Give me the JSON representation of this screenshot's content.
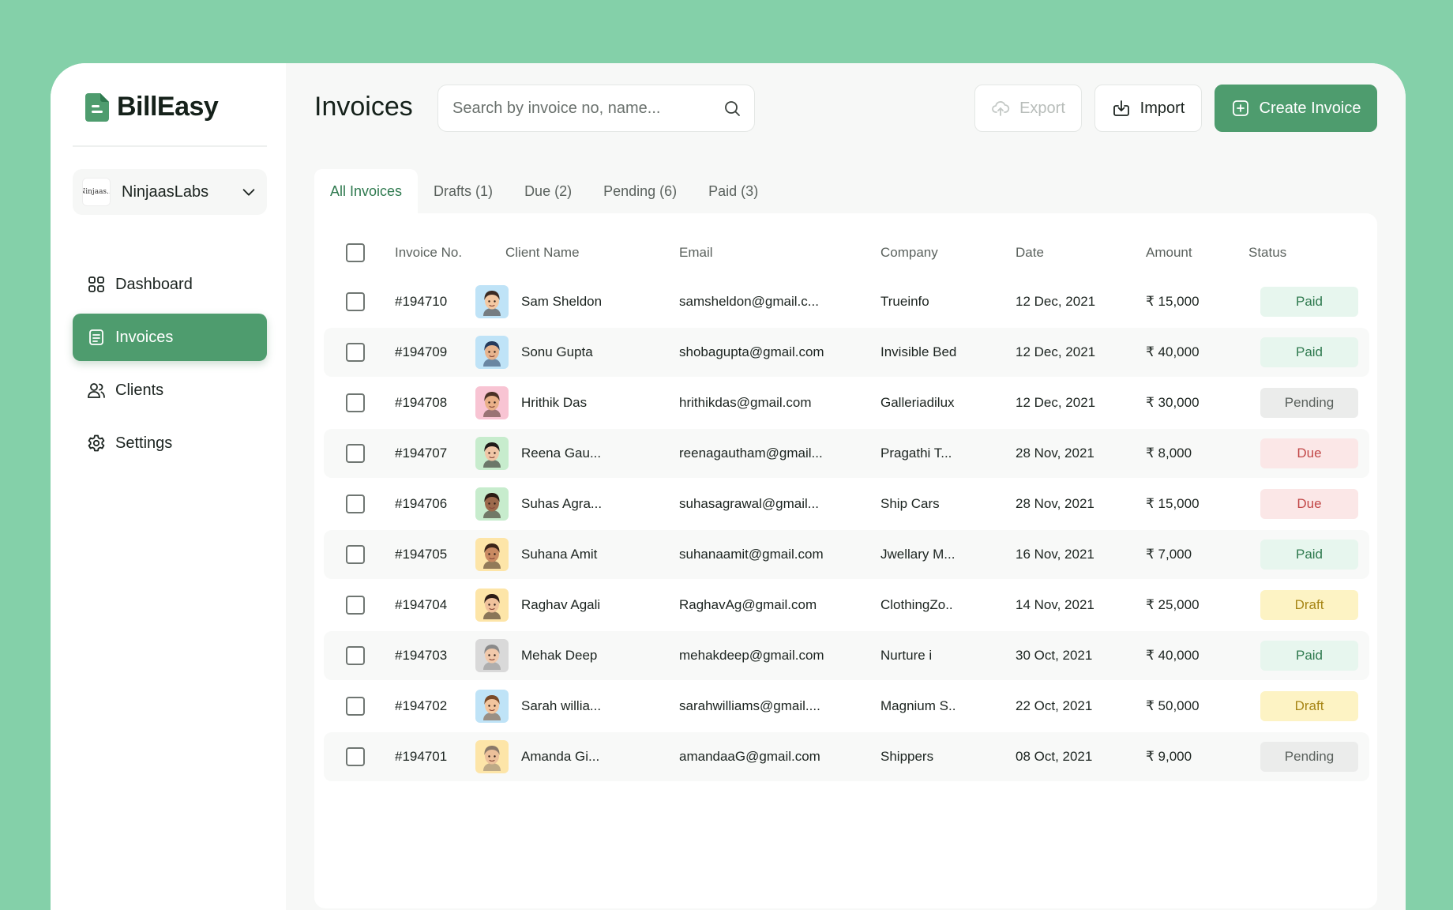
{
  "app": {
    "name": "BillEasy"
  },
  "workspace": {
    "logo_text": "Ninjaas...",
    "name": "NinjaasLabs"
  },
  "sidebar": {
    "items": [
      {
        "label": "Dashboard",
        "icon": "grid-icon"
      },
      {
        "label": "Invoices",
        "icon": "invoice-icon",
        "active": true
      },
      {
        "label": "Clients",
        "icon": "users-icon"
      },
      {
        "label": "Settings",
        "icon": "gear-icon"
      }
    ]
  },
  "header": {
    "title": "Invoices",
    "search_placeholder": "Search by invoice no, name...",
    "export_label": "Export",
    "import_label": "Import",
    "create_label": "Create Invoice"
  },
  "tabs": [
    {
      "label": "All Invoices",
      "active": true
    },
    {
      "label": "Drafts (1)"
    },
    {
      "label": "Due (2)"
    },
    {
      "label": "Pending (6)"
    },
    {
      "label": "Paid (3)"
    }
  ],
  "table": {
    "columns": [
      "Invoice No.",
      "Client Name",
      "Email",
      "Company",
      "Date",
      "Amount",
      "Status"
    ],
    "rows": [
      {
        "invoice": "#194710",
        "client": "Sam Sheldon",
        "email": "samsheldon@gmail.c...",
        "company": "Trueinfo",
        "date": "12 Dec, 2021",
        "amount": "₹ 15,000",
        "status": "Paid"
      },
      {
        "invoice": "#194709",
        "client": "Sonu Gupta",
        "email": "shobagupta@gmail.com",
        "company": "Invisible Bed",
        "date": "12 Dec, 2021",
        "amount": "₹ 40,000",
        "status": "Paid"
      },
      {
        "invoice": "#194708",
        "client": "Hrithik Das",
        "email": "hrithikdas@gmail.com",
        "company": "Galleriadilux",
        "date": "12 Dec, 2021",
        "amount": "₹ 30,000",
        "status": "Pending"
      },
      {
        "invoice": "#194707",
        "client": "Reena Gau...",
        "email": "reenagautham@gmail...",
        "company": "Pragathi T...",
        "date": "28 Nov, 2021",
        "amount": "₹ 8,000",
        "status": "Due"
      },
      {
        "invoice": "#194706",
        "client": "Suhas Agra...",
        "email": "suhasagrawal@gmail...",
        "company": "Ship Cars",
        "date": "28 Nov, 2021",
        "amount": "₹ 15,000",
        "status": "Due"
      },
      {
        "invoice": "#194705",
        "client": "Suhana Amit",
        "email": "suhanaamit@gmail.com",
        "company": "Jwellary M...",
        "date": "16 Nov, 2021",
        "amount": "₹ 7,000",
        "status": "Paid"
      },
      {
        "invoice": "#194704",
        "client": "Raghav Agali",
        "email": "RaghavAg@gmail.com",
        "company": "ClothingZo..",
        "date": "14 Nov, 2021",
        "amount": "₹ 25,000",
        "status": "Draft"
      },
      {
        "invoice": "#194703",
        "client": "Mehak Deep",
        "email": "mehakdeep@gmail.com",
        "company": "Nurture i",
        "date": "30 Oct, 2021",
        "amount": "₹ 40,000",
        "status": "Paid"
      },
      {
        "invoice": "#194702",
        "client": "Sarah willia...",
        "email": "sarahwilliams@gmail....",
        "company": "Magnium S..",
        "date": "22 Oct, 2021",
        "amount": "₹ 50,000",
        "status": "Draft"
      },
      {
        "invoice": "#194701",
        "client": "Amanda Gi...",
        "email": "amandaaG@gmail.com",
        "company": "Shippers",
        "date": "08 Oct, 2021",
        "amount": "₹ 9,000",
        "status": "Pending"
      }
    ]
  },
  "colors": {
    "background": "#84d0a9",
    "accent": "#4e9c6e",
    "paid": "#2f7a4f",
    "due": "#c24848",
    "draft": "#a78515",
    "pending": "#5b625e"
  },
  "avatars": [
    {
      "bg": "#bfe3f7",
      "skin": "#f3c8a2",
      "hair": "#3b2a22"
    },
    {
      "bg": "#bfe3f7",
      "skin": "#e7b48e",
      "hair": "#243a5c"
    },
    {
      "bg": "#f8c4d3",
      "skin": "#e9b088",
      "hair": "#4a3126"
    },
    {
      "bg": "#c7eccd",
      "skin": "#f0c6a6",
      "hair": "#1f1a18"
    },
    {
      "bg": "#c7eccd",
      "skin": "#9c6a4c",
      "hair": "#2a1c14"
    },
    {
      "bg": "#fde5a8",
      "skin": "#c98a62",
      "hair": "#3a2418"
    },
    {
      "bg": "#fde5a8",
      "skin": "#f0c29c",
      "hair": "#2b1c16"
    },
    {
      "bg": "#d9d9d9",
      "skin": "#f1c9ab",
      "hair": "#8a8a8a"
    },
    {
      "bg": "#bfe3f7",
      "skin": "#f2c59e",
      "hair": "#7a4a28"
    },
    {
      "bg": "#fde5a8",
      "skin": "#ecc09a",
      "hair": "#8a7a6a"
    }
  ]
}
